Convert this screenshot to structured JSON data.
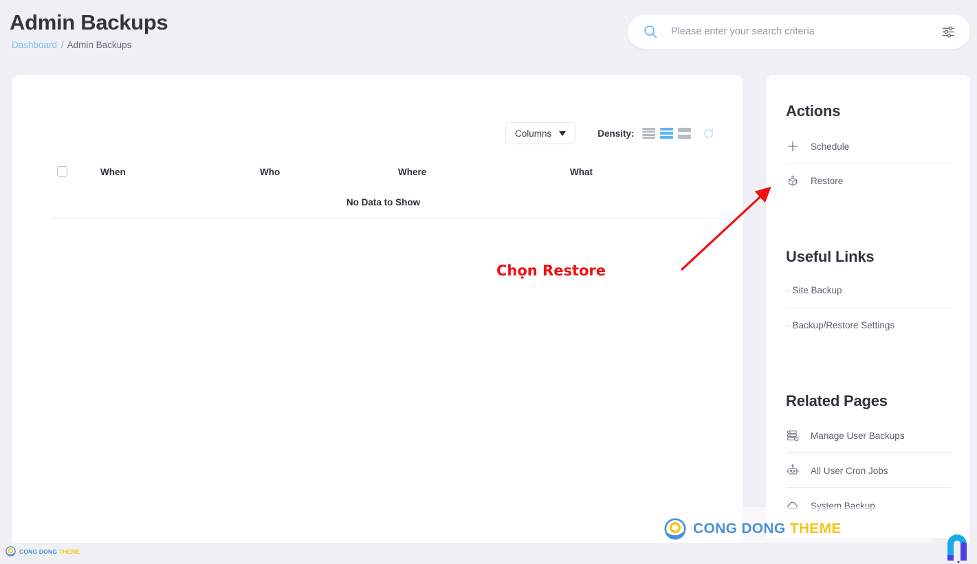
{
  "header": {
    "title": "Admin Backups",
    "breadcrumb": {
      "link": "Dashboard",
      "separator": "/",
      "current": "Admin Backups"
    }
  },
  "search": {
    "placeholder": "Please enter your search criteria",
    "value": "",
    "icon": "search-icon",
    "filter_icon": "sliders-filter-icon",
    "accent_color": "#5bb8f5"
  },
  "toolbar": {
    "columns_label": "Columns",
    "density_label": "Density:",
    "density_options": [
      "compact",
      "standard",
      "comfortable"
    ],
    "density_selected": "standard",
    "refresh_icon": "refresh-icon"
  },
  "table": {
    "columns": [
      "When",
      "Who",
      "Where",
      "What"
    ],
    "rows": [],
    "empty_message": "No Data to Show",
    "select_all_checked": false
  },
  "actions": {
    "title": "Actions",
    "items": [
      {
        "label": "Schedule",
        "icon": "plus-icon"
      },
      {
        "label": "Restore",
        "icon": "box-restore-icon"
      }
    ]
  },
  "useful_links": {
    "title": "Useful Links",
    "bullet": "·",
    "items": [
      {
        "label": "Site Backup"
      },
      {
        "label": "Backup/Restore Settings"
      }
    ]
  },
  "related_pages": {
    "title": "Related Pages",
    "items": [
      {
        "label": "Manage User Backups",
        "icon": "server-icon"
      },
      {
        "label": "All User Cron Jobs",
        "icon": "robot-icon"
      },
      {
        "label": "System Backup",
        "icon": "cloud-icon"
      }
    ]
  },
  "annotation": {
    "text": "Chọn Restore",
    "color": "#f01010",
    "arrow": "arrow-pointing-to-restore"
  },
  "watermark": {
    "text_primary": "CONG DONG",
    "text_secondary": "THEME",
    "primary_color": "#4a90d9",
    "secondary_color": "#f5c518"
  },
  "corner_logo": {
    "name": "n-logo"
  }
}
